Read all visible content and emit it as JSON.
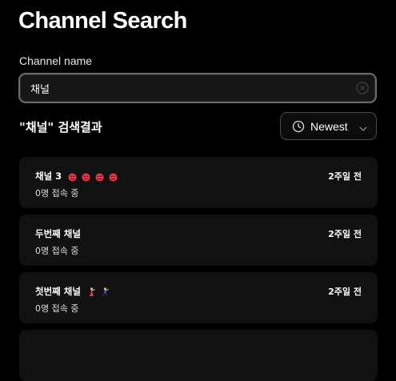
{
  "page": {
    "title": "Channel Search"
  },
  "search": {
    "label": "Channel name",
    "value": "채널",
    "clear_icon": "clear-circle-icon"
  },
  "results": {
    "heading": "\"채널\" 검색결과",
    "sort": {
      "label": "Newest",
      "icon": "clock-icon"
    }
  },
  "channels": [
    {
      "name": "채널 3",
      "emoji": [
        "angry-face",
        "angry-face",
        "angry-face",
        "angry-face"
      ],
      "users": "0명 접속 중",
      "time": "2주일 전"
    },
    {
      "name": "두번째 채널",
      "emoji": [],
      "users": "0명 접속 중",
      "time": "2주일 전"
    },
    {
      "name": "첫번째 채널",
      "emoji": [
        "dancer",
        "man-dancing"
      ],
      "users": "0명 접속 중",
      "time": "2주일 전"
    }
  ],
  "colors": {
    "background": "#000000",
    "card": "#111111",
    "border": "#6b6b6b"
  }
}
